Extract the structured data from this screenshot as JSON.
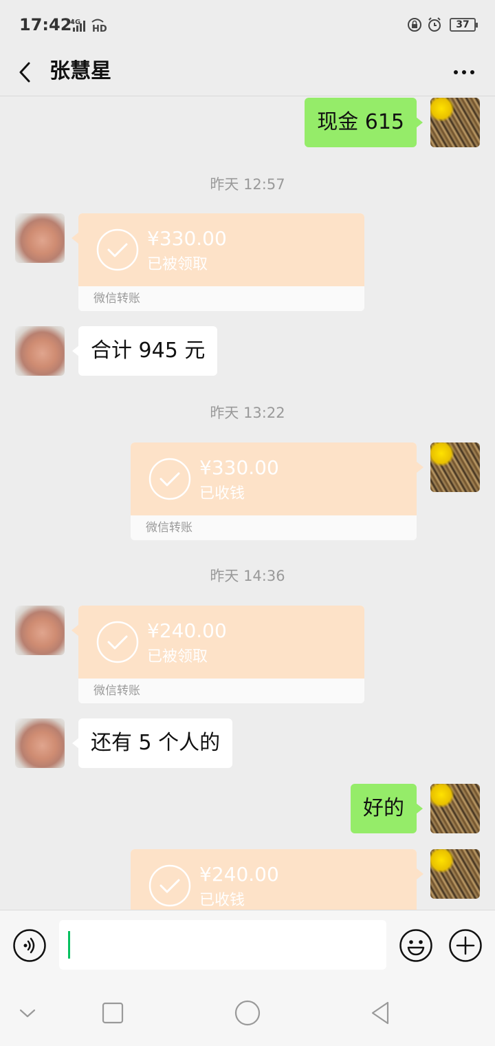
{
  "status_bar": {
    "time": "17:42",
    "network_label": "4G HD",
    "battery": "37",
    "icons": [
      "signal-icon",
      "lock-rotation-icon",
      "alarm-icon",
      "battery-icon"
    ]
  },
  "header": {
    "title": "张慧星",
    "icons": [
      "back-icon",
      "more-icon"
    ]
  },
  "messages": {
    "m1": {
      "text": "现金 615"
    },
    "t1": {
      "text": "昨天 12:57"
    },
    "tr1": {
      "amount": "¥330.00",
      "status": "已被领取",
      "footer": "微信转账"
    },
    "m2": {
      "text": "合计 945 元"
    },
    "t2": {
      "text": "昨天 13:22"
    },
    "tr2": {
      "amount": "¥330.00",
      "status": "已收钱",
      "footer": "微信转账"
    },
    "t3": {
      "text": "昨天 14:36"
    },
    "tr3": {
      "amount": "¥240.00",
      "status": "已被领取",
      "footer": "微信转账"
    },
    "m3": {
      "text": "还有 5 个人的"
    },
    "m4": {
      "text": "好的"
    },
    "tr4": {
      "amount": "¥240.00",
      "status": "已收钱"
    }
  },
  "input_bar": {
    "icons": [
      "voice-icon",
      "emoji-icon",
      "plus-icon"
    ],
    "cursor_color": "#07c160"
  },
  "system_nav": {
    "icons": [
      "chevron-down-icon",
      "recents-icon",
      "home-icon",
      "back-triangle-icon"
    ]
  },
  "colors": {
    "self_bubble": "#95ec69",
    "friend_bubble": "#ffffff",
    "transfer_card": "#fde2c8",
    "background": "#ededed"
  }
}
